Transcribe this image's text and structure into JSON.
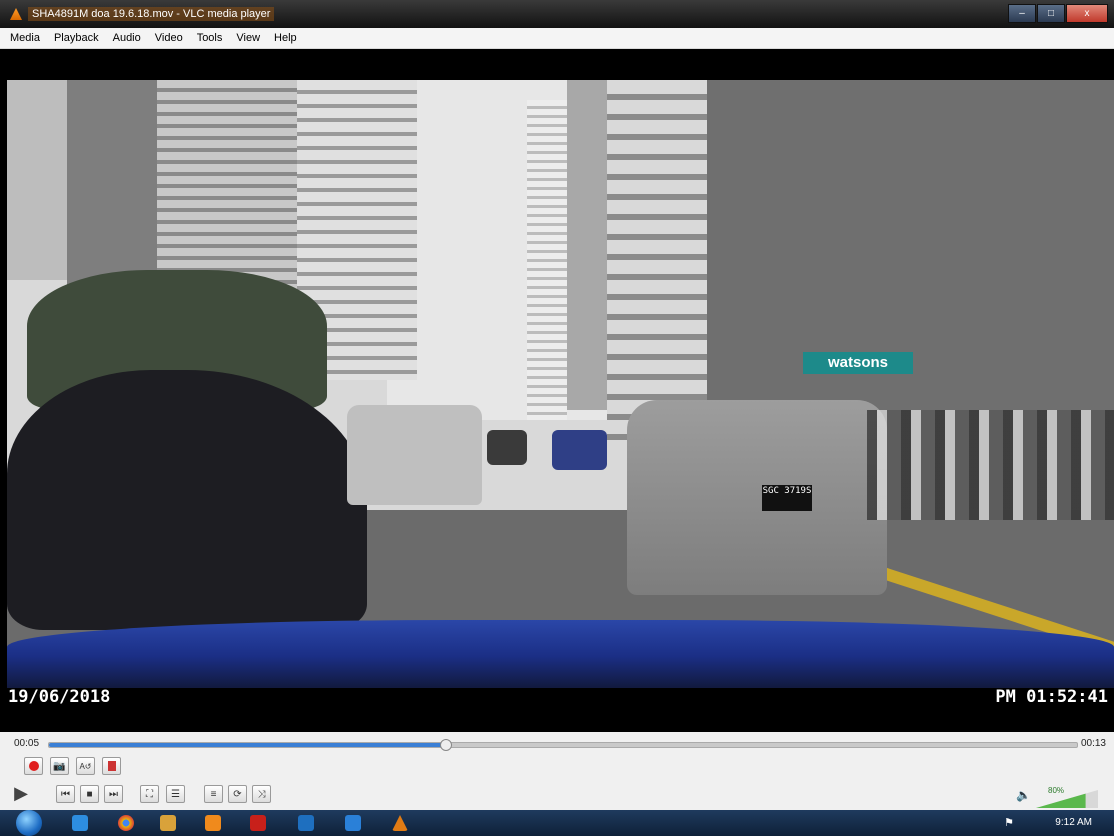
{
  "window": {
    "title": "SHA4891M doa 19.6.18.mov - VLC media player",
    "minimize_label": "–",
    "maximize_label": "□",
    "close_label": "x"
  },
  "menu": [
    "Media",
    "Playback",
    "Audio",
    "Video",
    "Tools",
    "View",
    "Help"
  ],
  "video": {
    "date_overlay": "19/06/2018",
    "time_overlay": "PM 01:52:41",
    "store_sign": "watsons",
    "plate_text": "SGC 3719S"
  },
  "playback": {
    "elapsed": "00:05",
    "total": "00:13",
    "progress_fraction": 0.385
  },
  "volume": {
    "percent_label": "80%",
    "level": 0.8
  },
  "colors": {
    "seek_fill": "#3a7fd5",
    "record": "#e01e1e",
    "taskbar": "#1f3b5e"
  },
  "taskbar": {
    "clock": "9:12 AM",
    "icons": [
      "start-orb",
      "ie",
      "chrome",
      "explorer",
      "media",
      "acrobat",
      "outlook",
      "vpn",
      "vlc"
    ]
  }
}
